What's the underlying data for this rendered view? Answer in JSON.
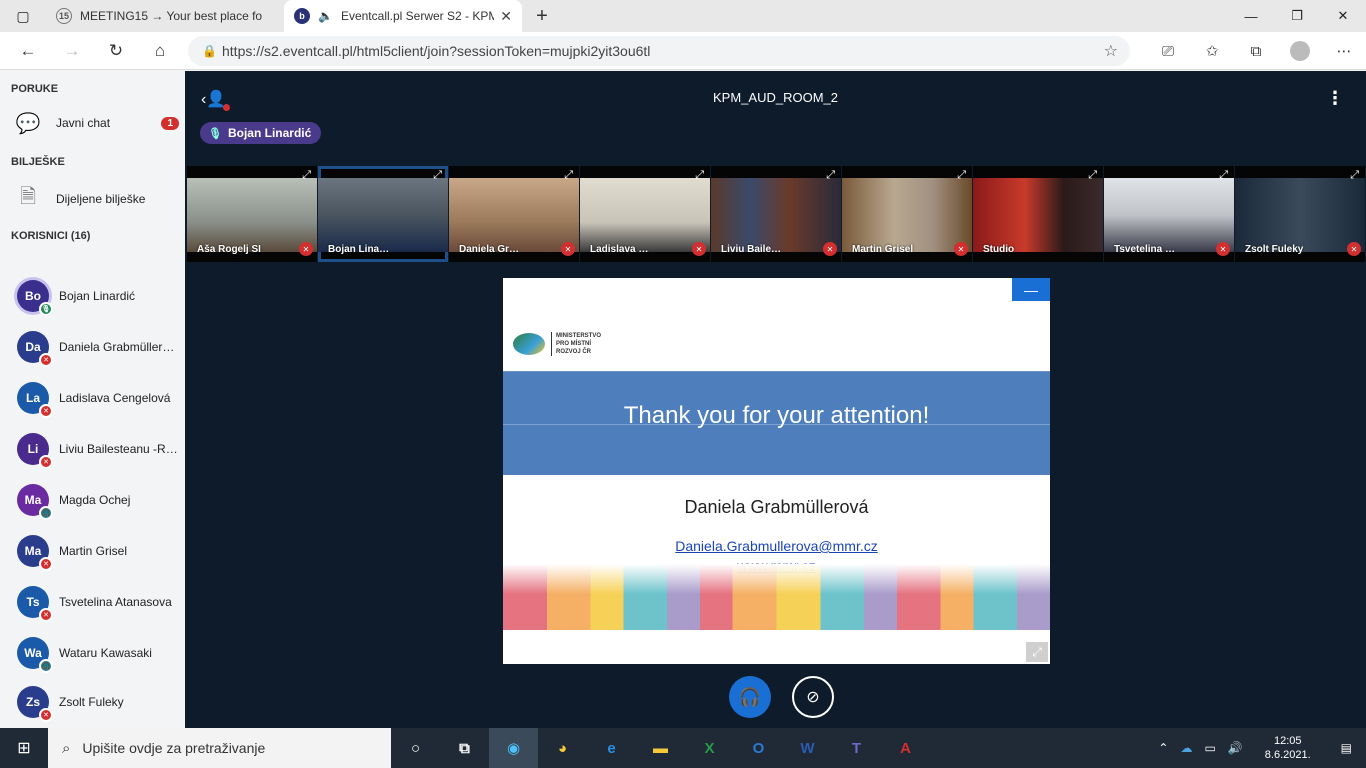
{
  "browser": {
    "tabs": [
      {
        "title": "MEETING15 → Your best place fo",
        "favicon": "15",
        "active": false
      },
      {
        "title": "Eventcall.pl Serwer S2 - KPM",
        "favicon": "b",
        "active": true
      }
    ],
    "url": "https://s2.eventcall.pl/html5client/join?sessionToken=mujpki2yit3ou6tl"
  },
  "sidebar": {
    "messages_heading": "PORUKE",
    "public_chat_label": "Javni chat",
    "public_chat_unread": "1",
    "notes_heading": "BILJEŠKE",
    "shared_notes_label": "Dijeljene bilješke",
    "users_heading": "KORISNICI (16)",
    "users": [
      {
        "initials": "Bo",
        "name": "Bojan Linardić",
        "color": "#3a2f8c",
        "status": "talking"
      },
      {
        "initials": "Da",
        "name": "Daniela Grabmüller…",
        "color": "#2a3c8c",
        "status": "muted"
      },
      {
        "initials": "La",
        "name": "Ladislava Cengelová",
        "color": "#1a5aa8",
        "status": "muted"
      },
      {
        "initials": "Li",
        "name": "Liviu Bailesteanu -R…",
        "color": "#4a2a8c",
        "status": "muted"
      },
      {
        "initials": "Ma",
        "name": "Magda Ochej",
        "color": "#6a2aa0",
        "status": "listen"
      },
      {
        "initials": "Ma",
        "name": "Martin Grisel",
        "color": "#2a3c8c",
        "status": "muted"
      },
      {
        "initials": "Ts",
        "name": "Tsvetelina Atanasova",
        "color": "#1a5aa8",
        "status": "muted"
      },
      {
        "initials": "Wa",
        "name": "Wataru Kawasaki",
        "color": "#1a5aa8",
        "status": "listen"
      },
      {
        "initials": "Zs",
        "name": "Zsolt Fuleky",
        "color": "#2a3c8c",
        "status": "muted"
      }
    ]
  },
  "room": {
    "title": "KPM_AUD_ROOM_2",
    "talking_indicator": "Bojan Linardić"
  },
  "videos": [
    {
      "name": "Aša Rogelj SI",
      "bg": "#8a8f8a",
      "selected": false
    },
    {
      "name": "Bojan Lina…",
      "bg": "#4a5560",
      "selected": true
    },
    {
      "name": "Daniela Gr…",
      "bg": "#9a7a5a",
      "selected": false
    },
    {
      "name": "Ladislava …",
      "bg": "#c8c4b8",
      "selected": false
    },
    {
      "name": "Liviu Baile…",
      "bg": "#5a3a2a",
      "selected": false
    },
    {
      "name": "Martin Grisel",
      "bg": "#7a5a3a",
      "selected": false
    },
    {
      "name": "Studio",
      "bg": "#2a1a1a",
      "selected": false
    },
    {
      "name": "Tsvetelina …",
      "bg": "#c0c4c8",
      "selected": false
    },
    {
      "name": "Zsolt Fuleky",
      "bg": "#1a2a3a",
      "selected": false
    }
  ],
  "slide": {
    "logo_text": "MINISTERSTVO PRO MÍSTNÍ ROZVOJ ČR",
    "heading": "Thank you for your attention!",
    "presenter": "Daniela Grabmüllerová",
    "email": "Daniela.Grabmullerova@mmr.cz",
    "website": "www.mmr.cz"
  },
  "taskbar": {
    "search_placeholder": "Upišite ovdje za pretraživanje",
    "time": "12:05",
    "date": "8.6.2021."
  }
}
